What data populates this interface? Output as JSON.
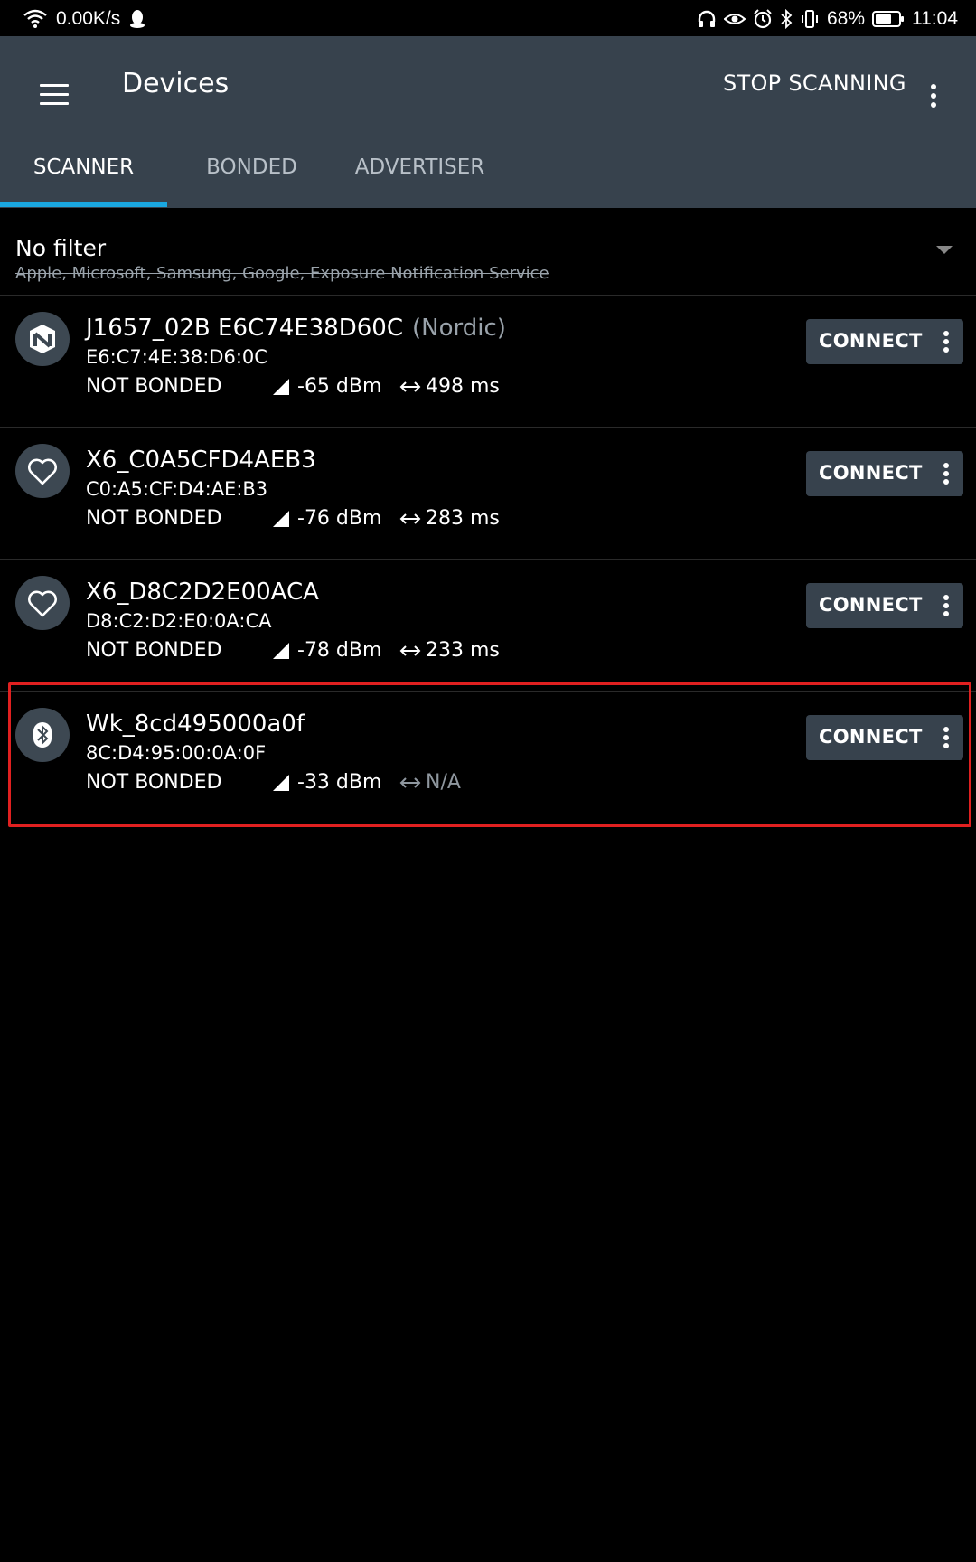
{
  "status_bar": {
    "speed": "0.00K/s",
    "battery": "68%",
    "time": "11:04"
  },
  "app_bar": {
    "title": "Devices",
    "stop_label": "STOP SCANNING"
  },
  "tabs": [
    {
      "label": "SCANNER",
      "active": true
    },
    {
      "label": "BONDED",
      "active": false
    },
    {
      "label": "ADVERTISER",
      "active": false
    }
  ],
  "filter": {
    "label": "No filter",
    "excluded": "Apple, Microsoft, Samsung, Google, Exposure Notification Service"
  },
  "devices": [
    {
      "icon": "nordic-icon",
      "name": "J1657_02B E6C74E38D60C",
      "vendor": "(Nordic)",
      "mac": "E6:C7:4E:38:D6:0C",
      "bond": "NOT BONDED",
      "rssi": "-65 dBm",
      "interval": "498 ms",
      "connect": "CONNECT"
    },
    {
      "icon": "heart-icon",
      "name": "X6_C0A5CFD4AEB3",
      "vendor": "",
      "mac": "C0:A5:CF:D4:AE:B3",
      "bond": "NOT BONDED",
      "rssi": "-76 dBm",
      "interval": "283 ms",
      "connect": "CONNECT"
    },
    {
      "icon": "heart-icon",
      "name": "X6_D8C2D2E00ACA",
      "vendor": "",
      "mac": "D8:C2:D2:E0:0A:CA",
      "bond": "NOT BONDED",
      "rssi": "-78 dBm",
      "interval": "233 ms",
      "connect": "CONNECT"
    },
    {
      "icon": "bluetooth-icon",
      "name": "Wk_8cd495000a0f",
      "vendor": "",
      "mac": "8C:D4:95:00:0A:0F",
      "bond": "NOT BONDED",
      "rssi": "-33 dBm",
      "interval": "N/A",
      "connect": "CONNECT"
    }
  ],
  "colors": {
    "app_bar": "#37424d",
    "tab_indicator": "#1aa7e0",
    "highlight": "#e02020",
    "avatar_bg": "#3d4852"
  }
}
